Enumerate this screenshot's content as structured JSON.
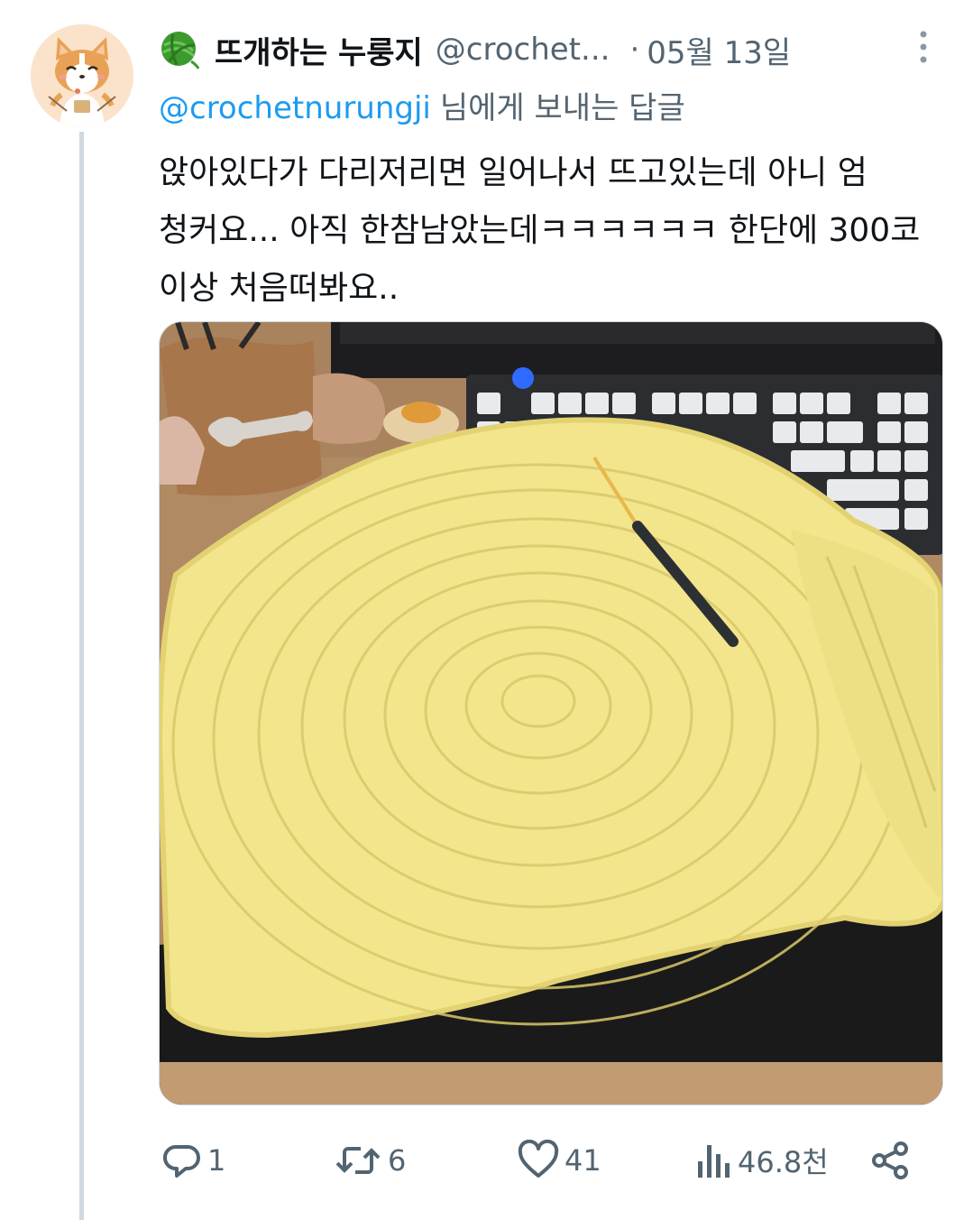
{
  "tweet": {
    "display_name": "뜨개하는 누룽지",
    "handle": "@crochet...",
    "dot": "·",
    "date": "05월 13일",
    "reply_to_handle": "@crochetnurungji",
    "reply_suffix": "님에게 보내는 답글",
    "text_lines": [
      "앉아있다가 다리저리면 일어나서 뜨고있는데 아니 엄",
      "청커요... 아직 한참남았는데ㅋㅋㅋㅋㅋㅋ 한단에 300코",
      "이상 처음떠봐요.."
    ]
  },
  "actions": {
    "reply_count": "1",
    "retweet_count": "6",
    "like_count": "41",
    "view_count": "46.8천"
  },
  "icons": {
    "avatar": "corgi-avatar",
    "badge": "yarn-ball-icon",
    "more": "more-vertical-icon",
    "reply": "reply-icon",
    "retweet": "retweet-icon",
    "like": "heart-icon",
    "views": "views-chart-icon",
    "share": "share-icon"
  },
  "colors": {
    "text_primary": "#0f1419",
    "text_secondary": "#536471",
    "link": "#1d9bf0",
    "thread_line": "#cfd9de",
    "yarn_green": "#3c9a2e",
    "crochet_yellow": "#f2e58c"
  }
}
